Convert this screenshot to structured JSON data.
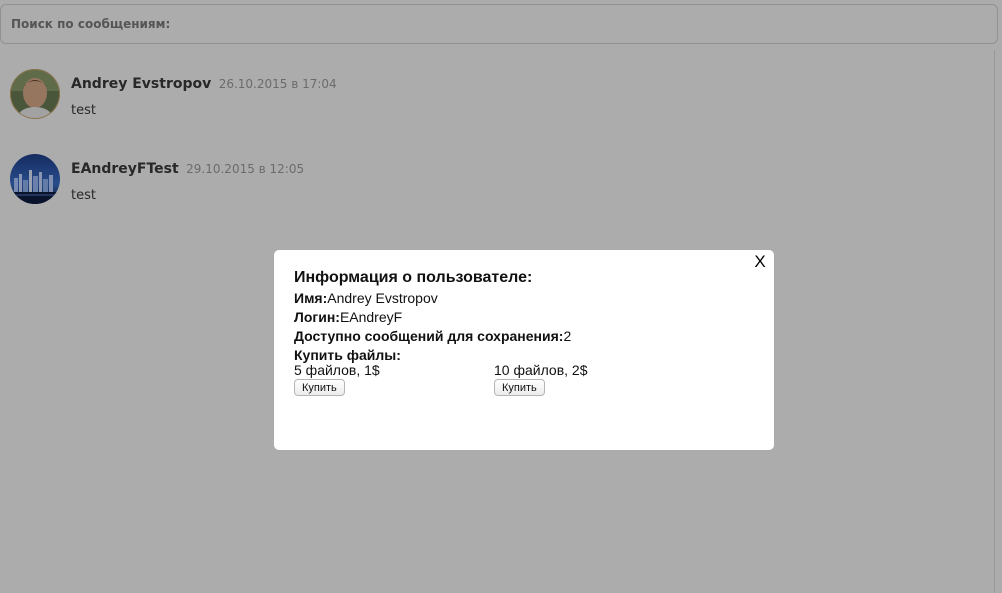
{
  "search": {
    "placeholder": "Поиск по сообщениям:"
  },
  "messages": [
    {
      "author": "Andrey Evstropov",
      "timestamp": "26.10.2015 в 17:04",
      "text": "test",
      "avatar_icon": "user-photo"
    },
    {
      "author": "EAndreyFTest",
      "timestamp": "29.10.2015 в 12:05",
      "text": "test",
      "avatar_icon": "city-skyline-photo"
    }
  ],
  "modal": {
    "close_label": "X",
    "title": "Информация о пользователе:",
    "name_key": "Имя:",
    "name_value": "Andrey Evstropov",
    "login_key": "Логин:",
    "login_value": "EAndreyF",
    "available_key": "Доступно сообщений для сохранения:",
    "available_value": "2",
    "buy_files_label": "Купить файлы:",
    "offers": [
      {
        "label": "5 файлов, 1$",
        "button_label": "Купить"
      },
      {
        "label": "10 файлов, 2$",
        "button_label": "Купить"
      }
    ]
  },
  "colors": {
    "overlay": "#000000",
    "modal_bg": "#ffffff",
    "author_text": "#3a3a3a",
    "timestamp_text": "#9a9a9a"
  }
}
